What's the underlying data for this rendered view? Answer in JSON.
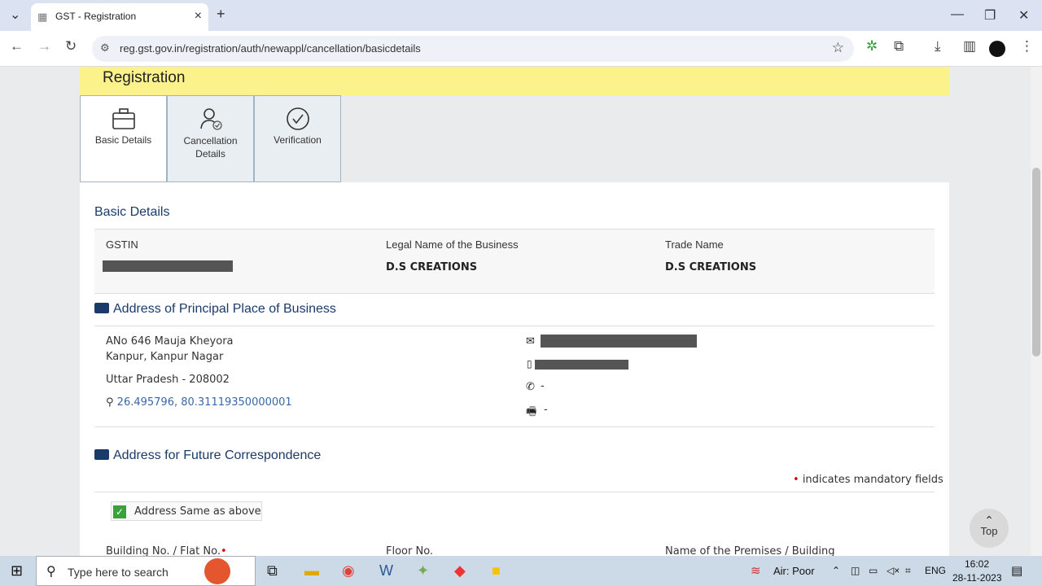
{
  "browser": {
    "tab_title": "GST - Registration",
    "url": "reg.gst.gov.in/registration/auth/newappl/cancellation/basicdetails"
  },
  "banner": {
    "title": "Registration"
  },
  "steps": [
    {
      "label": "Basic Details",
      "icon": "briefcase-icon"
    },
    {
      "label": "Cancellation Details",
      "icon": "user-check-icon"
    },
    {
      "label": "Verification",
      "icon": "check-circle-icon"
    }
  ],
  "basic": {
    "title": "Basic Details",
    "gstin_label": "GSTIN",
    "legal_label": "Legal Name of the Business",
    "legal_value": "D.S CREATIONS",
    "trade_label": "Trade Name",
    "trade_value": "D.S CREATIONS"
  },
  "principal": {
    "title": "Address of Principal Place of Business",
    "line1": "ANo 646 Mauja Kheyora",
    "line2": "Kanpur, Kanpur Nagar",
    "line3": "Uttar Pradesh - 208002",
    "coords": "26.495796, 80.3111935000000​1",
    "phone": "-",
    "fax": "-"
  },
  "future": {
    "title": "Address for Future Correspondence",
    "mandatory_note": "indicates mandatory fields",
    "same_label": "Address Same as above",
    "building_label": "Building No. / Flat No.",
    "floor_label": "Floor No.",
    "premises_label": "Name of the Premises / Building"
  },
  "top_button": "Top",
  "taskbar": {
    "search_placeholder": "Type here to search",
    "air": "Air: Poor",
    "lang": "ENG",
    "time": "16:02",
    "date": "28-11-2023"
  }
}
